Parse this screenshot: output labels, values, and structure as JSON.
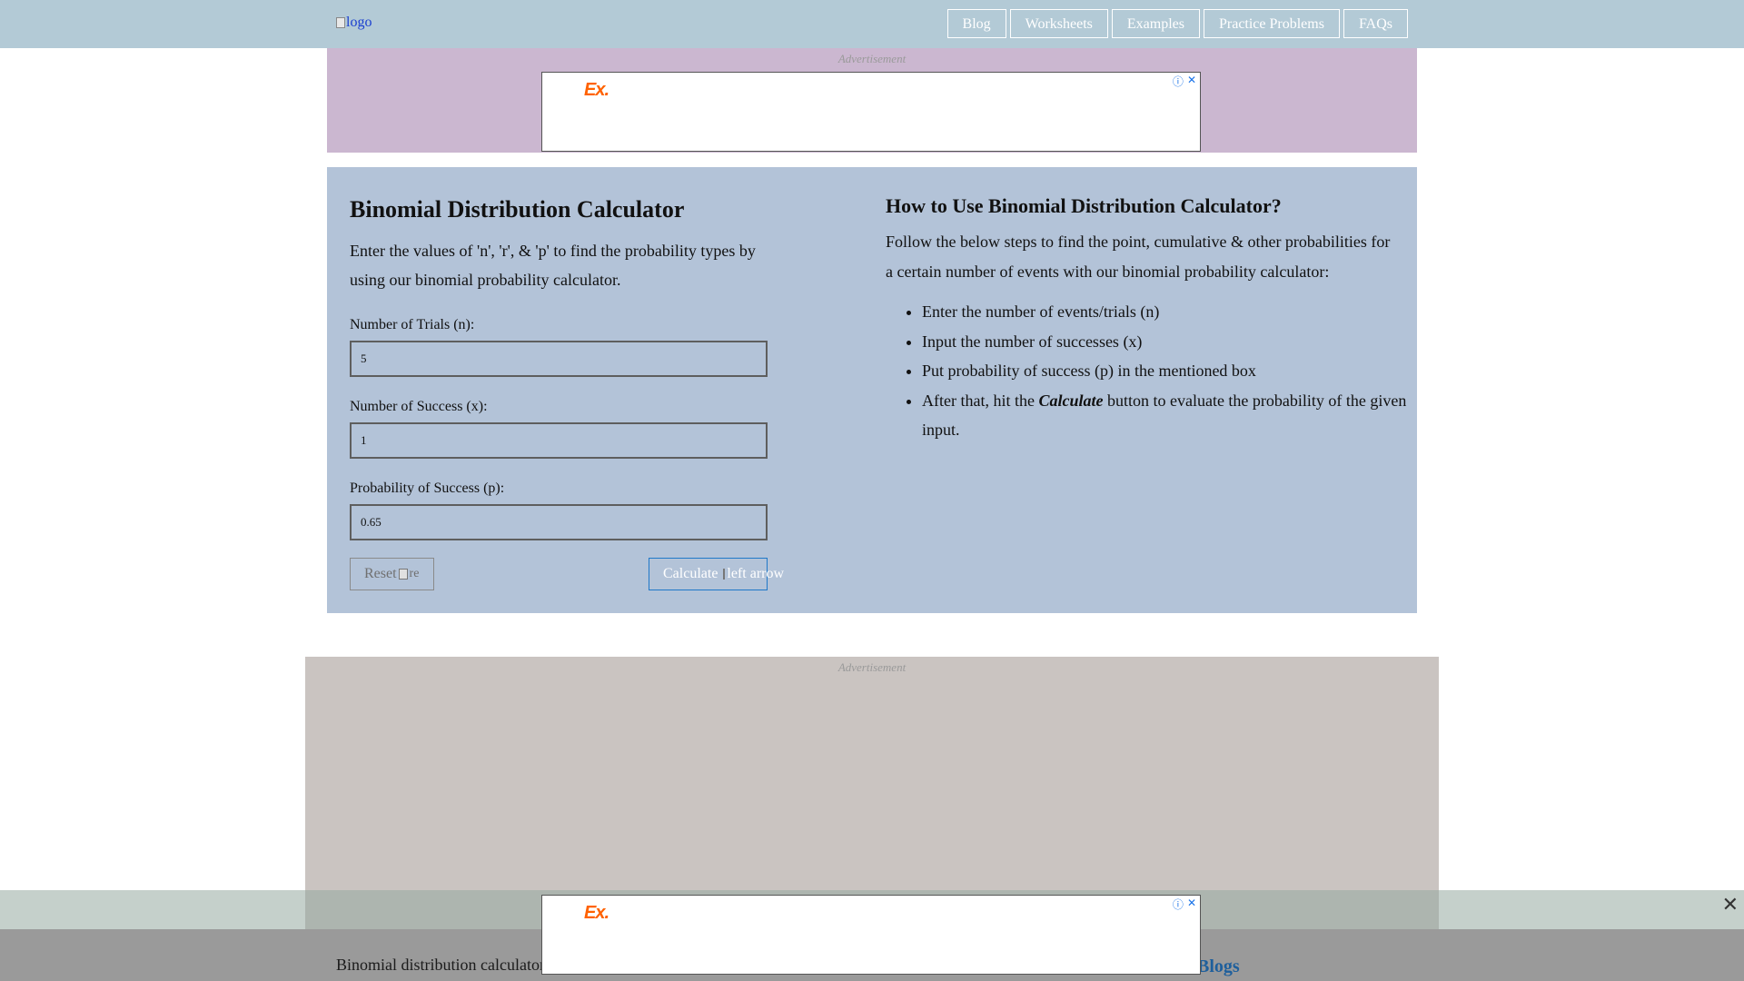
{
  "header": {
    "logo_alt": "logo",
    "nav": [
      "Blog",
      "Worksheets",
      "Examples",
      "Practice Problems",
      "FAQs"
    ]
  },
  "ads": {
    "label": "Advertisement",
    "brand": "Ex.",
    "info_icon": "ⓘ",
    "close_icon": "✕"
  },
  "calculator": {
    "title": "Binomial Distribution Calculator",
    "description": "Enter the values of 'n', 'r', & 'p' to find the probability types by using our binomial probability calculator.",
    "fields": [
      {
        "label": "Number of Trials (n):",
        "value": "5"
      },
      {
        "label": "Number of Success (x):",
        "value": "1"
      },
      {
        "label": "Probability of Success (p):",
        "value": "0.65"
      }
    ],
    "reset_label": "Reset",
    "reset_img_alt": "re",
    "calculate_label": "Calculate",
    "calculate_img_alt": "left arrow"
  },
  "howto": {
    "title": "How to Use Binomial Distribution Calculator?",
    "description": "Follow the below steps to find the point, cumulative & other probabilities for a certain number of events with our binomial probability calculator:",
    "steps": [
      "Enter the number of events/trials (n)",
      "Input the number of successes (x)",
      "Put probability of success (p) in the mentioned box"
    ],
    "last_step_prefix": "After that, hit the",
    "last_step_emph": "Calculate",
    "last_step_suffix": "button to evaluate the probability of the given input."
  },
  "sticky": {
    "close_icon": "✕"
  },
  "footer": {
    "text": "Binomial distribution calculator",
    "link": "Blogs"
  }
}
